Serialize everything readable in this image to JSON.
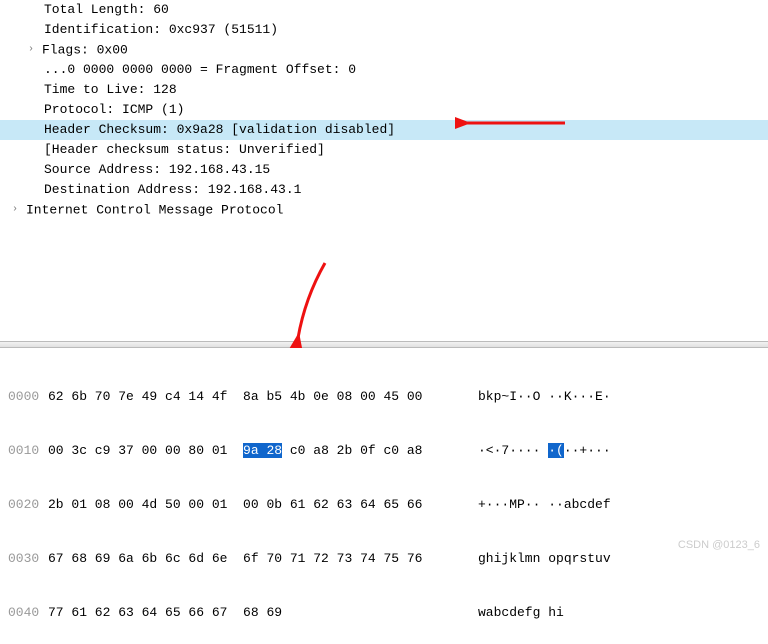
{
  "tree": {
    "rows": [
      {
        "indent": 2,
        "text": "Total Length: 60",
        "expandable": false,
        "highlighted": false
      },
      {
        "indent": 2,
        "text": "Identification: 0xc937 (51511)",
        "expandable": false,
        "highlighted": false
      },
      {
        "indent": 2,
        "text": "Flags: 0x00",
        "expandable": true,
        "highlighted": false
      },
      {
        "indent": 2,
        "text": "...0 0000 0000 0000 = Fragment Offset: 0",
        "expandable": false,
        "highlighted": false
      },
      {
        "indent": 2,
        "text": "Time to Live: 128",
        "expandable": false,
        "highlighted": false
      },
      {
        "indent": 2,
        "text": "Protocol: ICMP (1)",
        "expandable": false,
        "highlighted": false
      },
      {
        "indent": 2,
        "text": "Header Checksum: 0x9a28 [validation disabled]",
        "expandable": false,
        "highlighted": true
      },
      {
        "indent": 2,
        "text": "[Header checksum status: Unverified]",
        "expandable": false,
        "highlighted": false
      },
      {
        "indent": 2,
        "text": "Source Address: 192.168.43.15",
        "expandable": false,
        "highlighted": false
      },
      {
        "indent": 2,
        "text": "Destination Address: 192.168.43.1",
        "expandable": false,
        "highlighted": false
      },
      {
        "indent": 1,
        "text": "Internet Control Message Protocol",
        "expandable": true,
        "highlighted": false
      }
    ]
  },
  "hex": {
    "rows": [
      {
        "offset": "0000",
        "bytes_a": "62 6b 70 7e 49 c4 14 4f",
        "bytes_b_pre": "8a b5 4b 0e 08 00 45 00",
        "bytes_sel": "",
        "bytes_b_post": "",
        "ascii_pre": "bkp~I··O ··K···E·",
        "ascii_sel": "",
        "ascii_post": ""
      },
      {
        "offset": "0010",
        "bytes_a": "00 3c c9 37 00 00 80 01",
        "bytes_b_pre": "",
        "bytes_sel": "9a 28",
        "bytes_b_post": " c0 a8 2b 0f c0 a8",
        "ascii_pre": "·<·7···· ",
        "ascii_sel": "·(",
        "ascii_post": "··+···"
      },
      {
        "offset": "0020",
        "bytes_a": "2b 01 08 00 4d 50 00 01",
        "bytes_b_pre": "00 0b 61 62 63 64 65 66",
        "bytes_sel": "",
        "bytes_b_post": "",
        "ascii_pre": "+···MP·· ··abcdef",
        "ascii_sel": "",
        "ascii_post": ""
      },
      {
        "offset": "0030",
        "bytes_a": "67 68 69 6a 6b 6c 6d 6e",
        "bytes_b_pre": "6f 70 71 72 73 74 75 76",
        "bytes_sel": "",
        "bytes_b_post": "",
        "ascii_pre": "ghijklmn opqrstuv",
        "ascii_sel": "",
        "ascii_post": ""
      },
      {
        "offset": "0040",
        "bytes_a": "77 61 62 63 64 65 66 67",
        "bytes_b_pre": "68 69",
        "bytes_sel": "",
        "bytes_b_post": "",
        "ascii_pre": "wabcdefg hi",
        "ascii_sel": "",
        "ascii_post": ""
      }
    ]
  },
  "watermark": "CSDN @0123_6",
  "arrow_glyph": "›"
}
